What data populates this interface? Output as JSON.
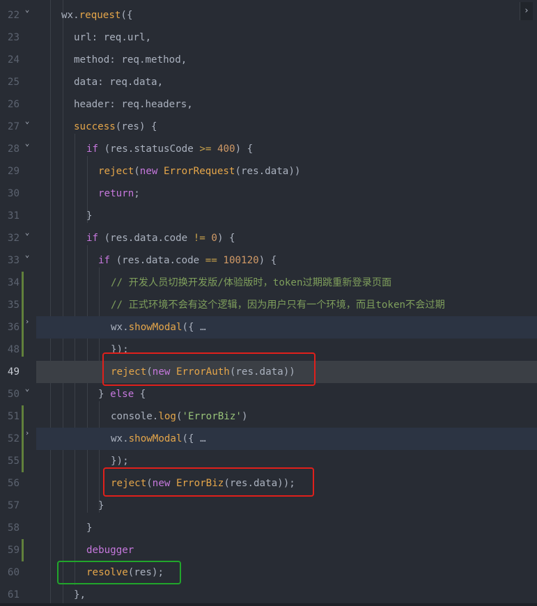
{
  "editor": {
    "expand_icon": "chevron-right-icon",
    "fold_icon_open": "chevron-down-icon",
    "fold_icon_closed": "chevron-right-icon",
    "highlight_colors": {
      "red": "#e0201b",
      "green": "#21a62b"
    }
  },
  "lines": [
    {
      "num": "22",
      "text": "wx.request({"
    },
    {
      "num": "23",
      "text": "url: req.url,"
    },
    {
      "num": "24",
      "text": "method: req.method,"
    },
    {
      "num": "25",
      "text": "data: req.data,"
    },
    {
      "num": "26",
      "text": "header: req.headers,"
    },
    {
      "num": "27",
      "text": "success(res) {"
    },
    {
      "num": "28",
      "text": "if (res.statusCode >= 400) {"
    },
    {
      "num": "29",
      "text": "reject(new ErrorRequest(res.data))"
    },
    {
      "num": "30",
      "text": "return;"
    },
    {
      "num": "31",
      "text": "}"
    },
    {
      "num": "32",
      "text": "if (res.data.code != 0) {"
    },
    {
      "num": "33",
      "text": "if (res.data.code == 100120) {"
    },
    {
      "num": "34",
      "text": "// 开发人员切换开发版/体验版时，token过期跳重新登录页面"
    },
    {
      "num": "35",
      "text": "// 正式环境不会有这个逻辑，因为用户只有一个环境，而且token不会过期"
    },
    {
      "num": "36",
      "text": "wx.showModal({ …"
    },
    {
      "num": "48",
      "text": "});"
    },
    {
      "num": "49",
      "text": "reject(new ErrorAuth(res.data))"
    },
    {
      "num": "50",
      "text": "} else {"
    },
    {
      "num": "51",
      "text": "console.log('ErrorBiz')"
    },
    {
      "num": "52",
      "text": "wx.showModal({ …"
    },
    {
      "num": "55",
      "text": "});"
    },
    {
      "num": "56",
      "text": "reject(new ErrorBiz(res.data));"
    },
    {
      "num": "57",
      "text": "}"
    },
    {
      "num": "58",
      "text": "}"
    },
    {
      "num": "59",
      "text": "debugger"
    },
    {
      "num": "60",
      "text": "resolve(res);"
    },
    {
      "num": "61",
      "text": "},"
    }
  ]
}
